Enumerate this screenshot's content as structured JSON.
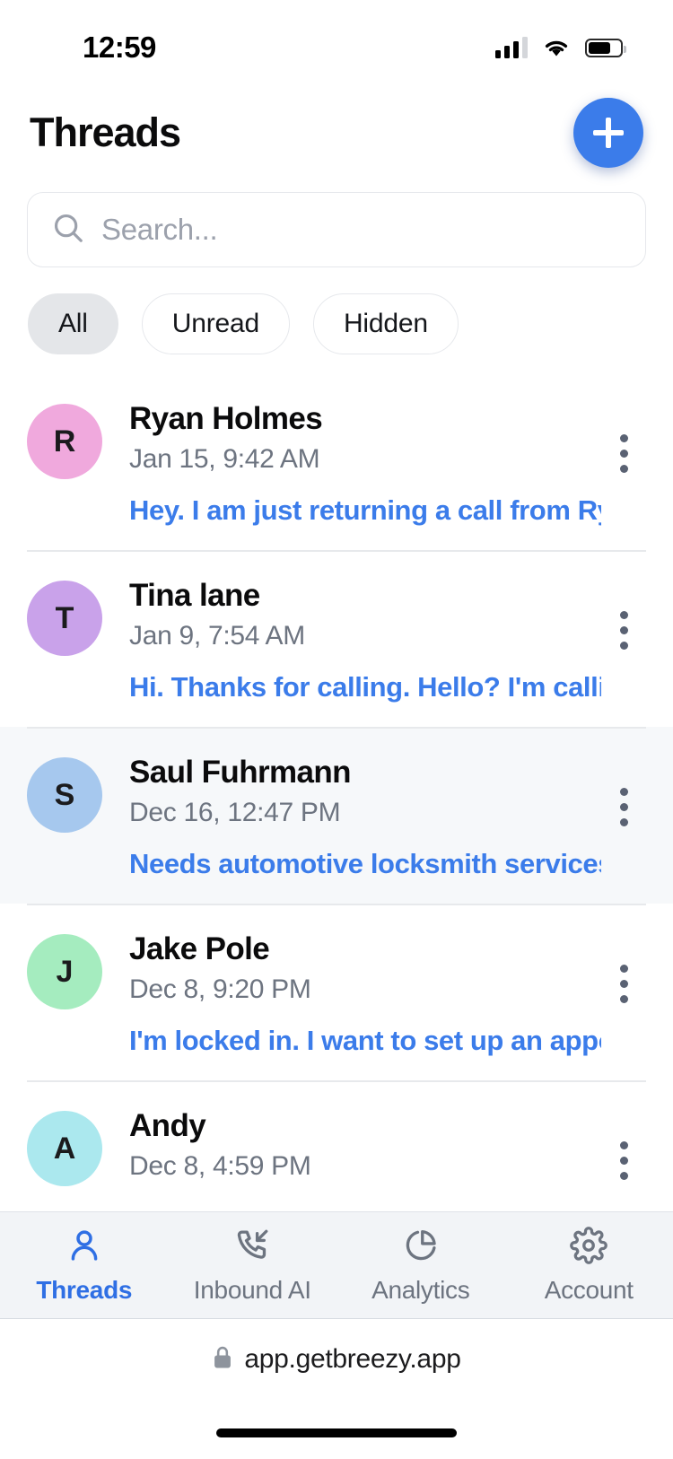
{
  "status_bar": {
    "time": "12:59",
    "signal_icon": "signal-bars-icon",
    "wifi_icon": "wifi-icon",
    "battery_icon": "battery-icon",
    "battery_level_pct": 70
  },
  "header": {
    "title": "Threads",
    "compose_button": {
      "icon": "plus-icon",
      "label": "+"
    }
  },
  "search": {
    "icon": "search-icon",
    "placeholder": "Search...",
    "value": ""
  },
  "filters": {
    "selected": "All",
    "chips": [
      {
        "label": "All",
        "active": true
      },
      {
        "label": "Unread",
        "active": false
      },
      {
        "label": "Hidden",
        "active": false
      }
    ]
  },
  "threads": [
    {
      "initial": "R",
      "avatar_color": "#f0a9dd",
      "name": "Ryan Holmes",
      "date": "Jan 15, 9:42 AM",
      "preview": "Hey. I am just returning a call from Rya...",
      "highlighted": false,
      "menu_icon": "kebab-menu-icon"
    },
    {
      "initial": "T",
      "avatar_color": "#c9a2ea",
      "name": "Tina lane",
      "date": "Jan 9, 7:54 AM",
      "preview": "Hi. Thanks for calling. Hello? I'm callin...",
      "highlighted": false,
      "menu_icon": "kebab-menu-icon"
    },
    {
      "initial": "S",
      "avatar_color": "#a6c8ee",
      "name": "Saul Fuhrmann",
      "date": "Dec 16, 12:47 PM",
      "preview": "Needs automotive locksmith services",
      "highlighted": true,
      "menu_icon": "kebab-menu-icon"
    },
    {
      "initial": "J",
      "avatar_color": "#a5ecbf",
      "name": "Jake Pole",
      "date": "Dec 8, 9:20 PM",
      "preview": "I'm locked in. I want to set up an appoi...",
      "highlighted": false,
      "menu_icon": "kebab-menu-icon"
    },
    {
      "initial": "A",
      "avatar_color": "#abe8ee",
      "name": "Andy",
      "date": "Dec 8, 4:59 PM",
      "preview": "",
      "highlighted": false,
      "menu_icon": "kebab-menu-icon"
    }
  ],
  "bottom_nav": {
    "active": "Threads",
    "items": [
      {
        "label": "Threads",
        "icon": "person-icon",
        "active": true
      },
      {
        "label": "Inbound AI",
        "icon": "phone-incoming-icon",
        "active": false
      },
      {
        "label": "Analytics",
        "icon": "pie-chart-icon",
        "active": false
      },
      {
        "label": "Account",
        "icon": "gear-icon",
        "active": false
      }
    ]
  },
  "browser": {
    "lock_icon": "lock-icon",
    "url": "app.getbreezy.app"
  },
  "colors": {
    "accent_blue": "#3b7cea",
    "nav_active": "#2f6fe4",
    "muted_text": "#6d7480",
    "highlight_row": "#f6f8fa",
    "chip_active_bg": "#e4e6e9"
  }
}
